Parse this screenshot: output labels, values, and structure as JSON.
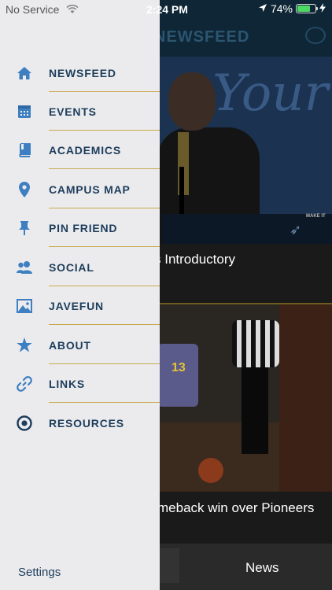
{
  "status_bar": {
    "carrier": "No Service",
    "time": "2:24 PM",
    "battery": "74%",
    "battery_level": 0.74
  },
  "background": {
    "header_title": "NEWSFEED",
    "story1_script": "Your",
    "story1_photo_text": "MAKE IT",
    "story1_caption": "s Introductory",
    "story2_jersey_number": "13",
    "story2_caption": "meback win over Pioneers",
    "tab_news": "News"
  },
  "drawer": {
    "items": [
      {
        "label": "NEWSFEED",
        "icon": "home-icon"
      },
      {
        "label": "EVENTS",
        "icon": "calendar-icon"
      },
      {
        "label": "ACADEMICS",
        "icon": "book-icon"
      },
      {
        "label": "CAMPUS MAP",
        "icon": "map-pin-icon"
      },
      {
        "label": "PIN FRIEND",
        "icon": "pushpin-icon"
      },
      {
        "label": "SOCIAL",
        "icon": "people-icon"
      },
      {
        "label": "JAVEFUN",
        "icon": "image-icon"
      },
      {
        "label": "ABOUT",
        "icon": "star-icon"
      },
      {
        "label": "LINKS",
        "icon": "link-icon"
      },
      {
        "label": "RESOURCES",
        "icon": "target-icon"
      }
    ],
    "settings_label": "Settings"
  },
  "colors": {
    "drawer_bg": "#ebebed",
    "accent_text": "#1d3d5c",
    "icon": "#3d7fc1",
    "separator": "#c9a94e"
  }
}
